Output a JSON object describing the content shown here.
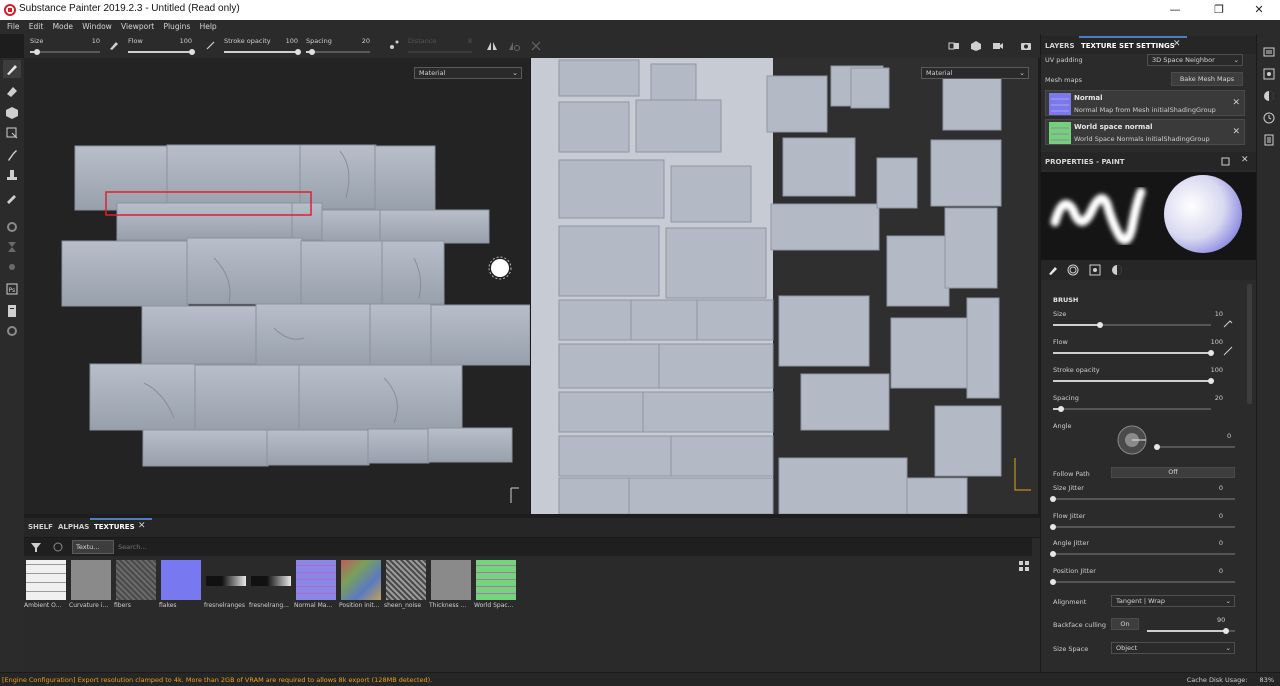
{
  "window": {
    "title": "Substance Painter 2019.2.3 - Untitled (Read only)",
    "minimize": "—",
    "maximize": "❐",
    "close": "✕"
  },
  "menu": [
    "File",
    "Edit",
    "Mode",
    "Window",
    "Viewport",
    "Plugins",
    "Help"
  ],
  "toolbar": {
    "size": {
      "label": "Size",
      "value": "10",
      "fraction": 0.1
    },
    "flow": {
      "label": "Flow",
      "value": "100",
      "fraction": 1.0
    },
    "stroke_opacity": {
      "label": "Stroke opacity",
      "value": "100",
      "fraction": 1.0
    },
    "spacing": {
      "label": "Spacing",
      "value": "20",
      "fraction": 0.1
    },
    "distance": {
      "label": "Distance",
      "value": "8"
    }
  },
  "viewport3d": {
    "material_select": "Material"
  },
  "viewport2d": {
    "material_select": "Material"
  },
  "shelf": {
    "tabs": [
      "SHELF",
      "ALPHAS",
      "TEXTURES"
    ],
    "active_tab": "TEXTURES",
    "filter_chip": "Textu...",
    "search_placeholder": "Search...",
    "items": [
      {
        "name": "Ambient O...",
        "color": "#e8e8e8",
        "kind": "ao"
      },
      {
        "name": "Curvature i...",
        "color": "#8a8a8a",
        "kind": "curv"
      },
      {
        "name": "fibers",
        "color": "#6a6a6a",
        "kind": "noise"
      },
      {
        "name": "flakes",
        "color": "#7878f0",
        "kind": "flat"
      },
      {
        "name": "fresnelranges",
        "color": "#202020",
        "kind": "gradient"
      },
      {
        "name": "fresnelrang...",
        "color": "#202020",
        "kind": "gradient"
      },
      {
        "name": "Normal Ma...",
        "color": "#8a86e8",
        "kind": "normal"
      },
      {
        "name": "Position init...",
        "color": "#c08a80",
        "kind": "position"
      },
      {
        "name": "sheen_noise",
        "color": "#9a9a9a",
        "kind": "noise"
      },
      {
        "name": "Thickness ...",
        "color": "#8a8a8a",
        "kind": "curv"
      },
      {
        "name": "World Spac...",
        "color": "#74d47a",
        "kind": "world"
      }
    ]
  },
  "status": {
    "message": "[Engine Configuration] Export resolution clamped to 4k. More than 2GB of VRAM are required to allows 8k export (128MB detected).",
    "cache_label": "Cache Disk Usage:",
    "cache_value": "83%"
  },
  "right_panel": {
    "tabs": [
      "LAYERS",
      "TEXTURE SET SETTINGS"
    ],
    "uv_padding_label": "UV padding",
    "uv_padding_value": "3D Space Neighbor",
    "mesh_maps_label": "Mesh maps",
    "bake_button": "Bake Mesh Maps",
    "mesh_maps": [
      {
        "name": "Normal",
        "desc": "Normal Map from Mesh initialShadingGroup",
        "color": "#7a78ea"
      },
      {
        "name": "World space normal",
        "desc": "World Space Normals initialShadingGroup",
        "color": "#6fd477"
      }
    ],
    "properties_title": "PROPERTIES - PAINT",
    "brush_title": "BRUSH",
    "sliders": [
      {
        "label": "Size",
        "value": "10",
        "fraction": 0.3
      },
      {
        "label": "Flow",
        "value": "100",
        "fraction": 1.0
      },
      {
        "label": "Stroke opacity",
        "value": "100",
        "fraction": 1.0
      },
      {
        "label": "Spacing",
        "value": "20",
        "fraction": 0.05
      }
    ],
    "angle": {
      "label": "Angle",
      "value": "0"
    },
    "follow_path": {
      "label": "Follow Path",
      "value": "Off"
    },
    "jitters": [
      {
        "label": "Size Jitter",
        "value": "0"
      },
      {
        "label": "Flow Jitter",
        "value": "0"
      },
      {
        "label": "Angle Jitter",
        "value": "0"
      },
      {
        "label": "Position Jitter",
        "value": "0"
      }
    ],
    "alignment": {
      "label": "Alignment",
      "value": "Tangent | Wrap"
    },
    "backface": {
      "label": "Backface culling",
      "toggle": "On",
      "value": "90",
      "fraction": 0.9
    },
    "size_space": {
      "label": "Size Space",
      "value": "Object"
    }
  }
}
